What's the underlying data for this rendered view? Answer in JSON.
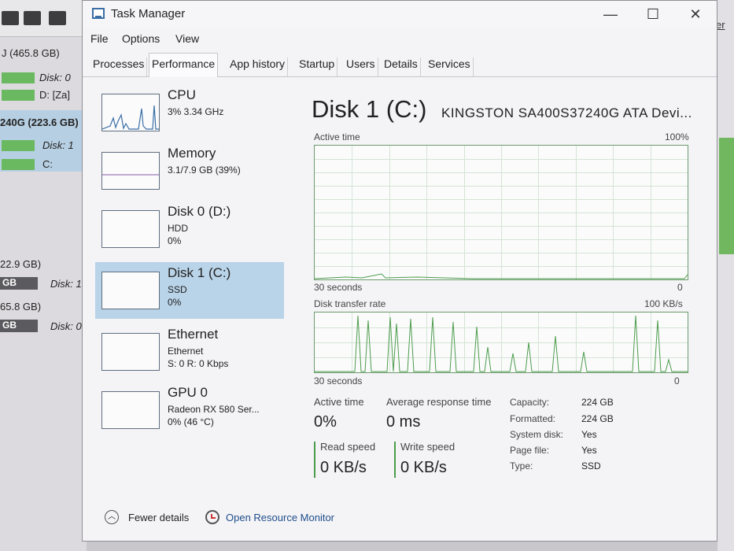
{
  "background_window": {
    "lines": [
      {
        "text": "J (465.8 GB)"
      },
      {
        "text": "Disk: 0"
      },
      {
        "text": "D: [Za]"
      },
      {
        "text": "240G (223.6 GB)"
      },
      {
        "text": "Disk: 1"
      },
      {
        "text": "C:"
      },
      {
        "text": "22.9 GB)"
      },
      {
        "text": "GB"
      },
      {
        "text": "Disk: 1"
      },
      {
        "text": "65.8 GB)"
      },
      {
        "text": "GB"
      },
      {
        "text": "Disk: 0"
      }
    ],
    "right_link": "er"
  },
  "window": {
    "title": "Task Manager",
    "minimize": "—",
    "maximize": "☐",
    "close": "✕"
  },
  "menu": [
    "File",
    "Options",
    "View"
  ],
  "tabs": [
    "Processes",
    "Performance",
    "App history",
    "Startup",
    "Users",
    "Details",
    "Services"
  ],
  "active_tab": "Performance",
  "perf_list": [
    {
      "name": "CPU",
      "lines": [
        "3% 3.34 GHz"
      ]
    },
    {
      "name": "Memory",
      "lines": [
        "3.1/7.9 GB (39%)"
      ]
    },
    {
      "name": "Disk 0 (D:)",
      "lines": [
        "HDD",
        "0%"
      ]
    },
    {
      "name": "Disk 1 (C:)",
      "lines": [
        "SSD",
        "0%"
      ]
    },
    {
      "name": "Ethernet",
      "lines": [
        "Ethernet",
        "S: 0 R: 0 Kbps"
      ]
    },
    {
      "name": "GPU 0",
      "lines": [
        "Radeon RX 580 Ser...",
        "0% (46 °C)"
      ]
    }
  ],
  "detail": {
    "title": "Disk 1 (C:)",
    "model": "KINGSTON SA400S37240G ATA Devi...",
    "graph1": {
      "label": "Active time",
      "max": "100%",
      "time": "30 seconds",
      "min": "0"
    },
    "graph2": {
      "label": "Disk transfer rate",
      "max": "100 KB/s",
      "time": "30 seconds",
      "min": "0"
    },
    "stats": {
      "active_time_label": "Active time",
      "active_time_value": "0%",
      "avg_resp_label": "Average response time",
      "avg_resp_value": "0 ms",
      "read_label": "Read speed",
      "read_value": "0 KB/s",
      "write_label": "Write speed",
      "write_value": "0 KB/s"
    },
    "props": [
      {
        "key": "Capacity:",
        "value": "224 GB"
      },
      {
        "key": "Formatted:",
        "value": "224 GB"
      },
      {
        "key": "System disk:",
        "value": "Yes"
      },
      {
        "key": "Page file:",
        "value": "Yes"
      },
      {
        "key": "Type:",
        "value": "SSD"
      }
    ]
  },
  "footer": {
    "fewer": "Fewer details",
    "resmon": "Open Resource Monitor"
  },
  "colors": {
    "selection": "#b9d3e8",
    "graph_line": "#4c9c4c",
    "link": "#1e4e8c"
  }
}
